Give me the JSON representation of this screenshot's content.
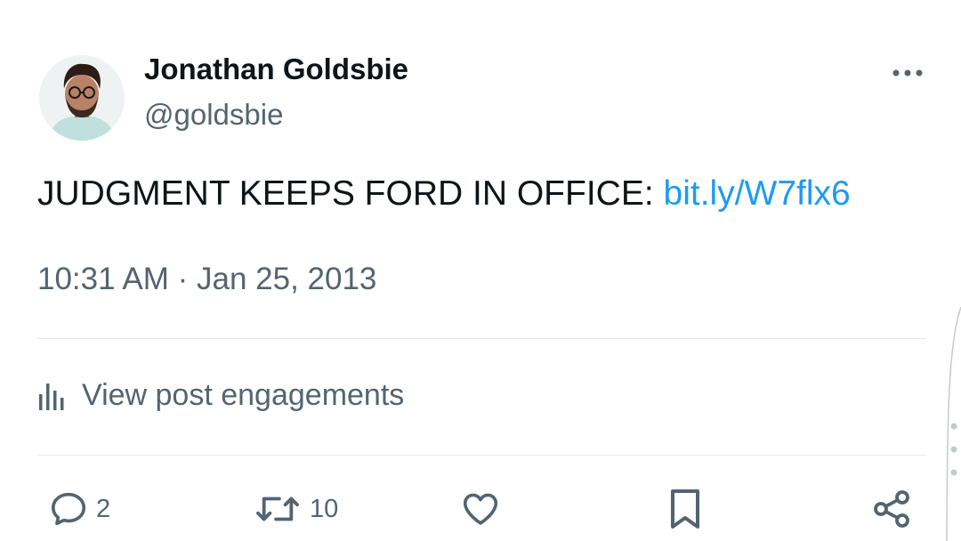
{
  "author": {
    "display_name": "Jonathan Goldsbie",
    "handle": "@goldsbie",
    "avatar_icon": "avatar-photo"
  },
  "post": {
    "text_prefix": "JUDGMENT KEEPS FORD IN OFFICE: ",
    "link_text": "bit.ly/W7flx6",
    "timestamp": "10:31 AM · Jan 25, 2013"
  },
  "engagements": {
    "label": "View post engagements",
    "icon": "bar-chart-icon"
  },
  "actions": {
    "reply_count": "2",
    "repost_count": "10",
    "like_icon": "heart-icon",
    "bookmark_icon": "bookmark-icon",
    "share_icon": "share-icon"
  },
  "colors": {
    "link": "#1d9bf0",
    "secondary_text": "#536471",
    "primary_text": "#0f1419",
    "divider": "#e6ecf0"
  }
}
